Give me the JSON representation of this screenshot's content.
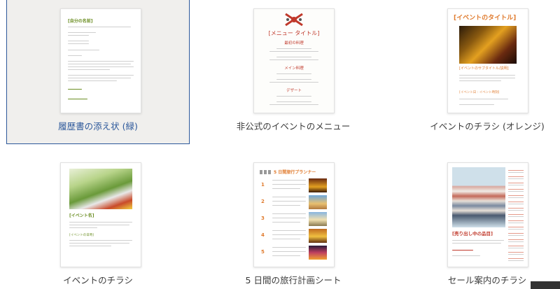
{
  "templates": [
    {
      "caption": "履歴書の添え状 (緑)",
      "thumb_title": "[自分の名前]",
      "thumb_sub": "[返信用住所]",
      "thumb_block1": "[日付]",
      "thumb_block2": "[受信者の名前]"
    },
    {
      "caption": "非公式のイベントのメニュー",
      "thumb_title": "[メニュー タイトル]",
      "sections": [
        "最初の料理",
        "メイン料理",
        "デザート"
      ]
    },
    {
      "caption": "イベントのチラシ (オレンジ)",
      "thumb_title": "[イベントのタイトル]",
      "thumb_sub": "[イベントのサブタイトル/説明]",
      "thumb_sub2": "[イベント日 : イベント時刻]"
    },
    {
      "caption": "イベントのチラシ",
      "thumb_title": "[イベント名]",
      "thumb_sub": "[イベントの日時]"
    },
    {
      "caption": "5 日間の旅行計画シート",
      "thumb_title": "5 日間旅行プランナー",
      "days": [
        "1",
        "2",
        "3",
        "4",
        "5"
      ]
    },
    {
      "caption": "セール案内のチラシ",
      "thumb_title": "[売り出し中の品目]"
    }
  ],
  "colors": {
    "accent": "#2b579a",
    "orange": "#e07b2e",
    "red_title": "#c0392b",
    "green": "#6b8e23"
  }
}
